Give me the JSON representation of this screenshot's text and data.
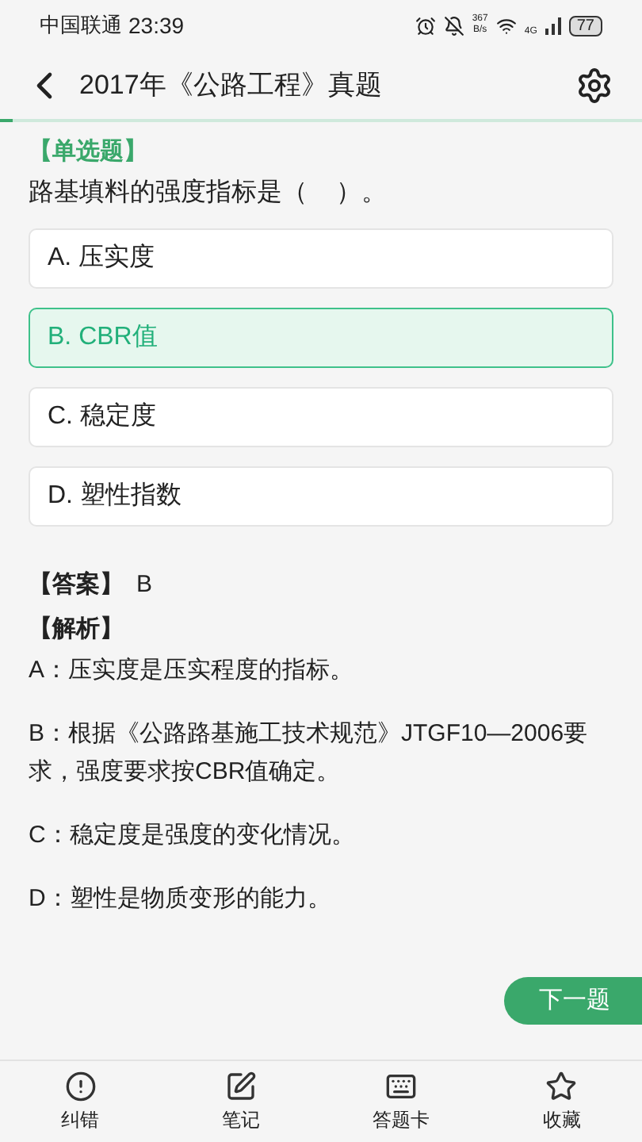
{
  "status_bar": {
    "carrier": "中国联通",
    "time": "23:39",
    "speed_value": "367",
    "speed_unit": "B/s",
    "network": "4G",
    "battery": "77"
  },
  "header": {
    "title": "2017年《公路工程》真题",
    "progress": {
      "level": 0.02
    }
  },
  "question": {
    "type": "【单选题】",
    "text": "路基填料的强度指标是（    ）。",
    "options": [
      {
        "label": "A. 压实度",
        "selected": false
      },
      {
        "label": "B. CBR值",
        "selected": true
      },
      {
        "label": "C. 稳定度",
        "selected": false
      },
      {
        "label": "D. 塑性指数",
        "selected": false
      }
    ]
  },
  "answer": {
    "label": "【答案】",
    "value": "B"
  },
  "analysis": {
    "label": "【解析】",
    "lines": [
      "A：压实度是压实程度的指标。",
      "B：根据《公路路基施工技术规范》JTGF10—2006要求，强度要求按CBR值确定。",
      "C：稳定度是强度的变化情况。",
      "D：塑性是物质变形的能力。"
    ]
  },
  "next_button": "下一题",
  "bottom_nav": [
    {
      "kind": "report",
      "label": "纠错"
    },
    {
      "kind": "note",
      "label": "笔记"
    },
    {
      "kind": "card",
      "label": "答题卡"
    },
    {
      "kind": "favorite",
      "label": "收藏"
    }
  ]
}
